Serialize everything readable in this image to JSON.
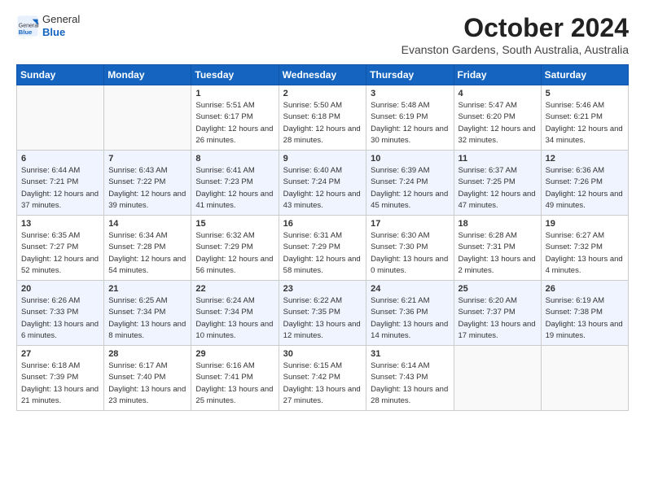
{
  "header": {
    "logo_general": "General",
    "logo_blue": "Blue",
    "month_year": "October 2024",
    "location": "Evanston Gardens, South Australia, Australia"
  },
  "weekdays": [
    "Sunday",
    "Monday",
    "Tuesday",
    "Wednesday",
    "Thursday",
    "Friday",
    "Saturday"
  ],
  "weeks": [
    [
      {
        "day": "",
        "sunrise": "",
        "sunset": "",
        "daylight": ""
      },
      {
        "day": "",
        "sunrise": "",
        "sunset": "",
        "daylight": ""
      },
      {
        "day": "1",
        "sunrise": "Sunrise: 5:51 AM",
        "sunset": "Sunset: 6:17 PM",
        "daylight": "Daylight: 12 hours and 26 minutes."
      },
      {
        "day": "2",
        "sunrise": "Sunrise: 5:50 AM",
        "sunset": "Sunset: 6:18 PM",
        "daylight": "Daylight: 12 hours and 28 minutes."
      },
      {
        "day": "3",
        "sunrise": "Sunrise: 5:48 AM",
        "sunset": "Sunset: 6:19 PM",
        "daylight": "Daylight: 12 hours and 30 minutes."
      },
      {
        "day": "4",
        "sunrise": "Sunrise: 5:47 AM",
        "sunset": "Sunset: 6:20 PM",
        "daylight": "Daylight: 12 hours and 32 minutes."
      },
      {
        "day": "5",
        "sunrise": "Sunrise: 5:46 AM",
        "sunset": "Sunset: 6:21 PM",
        "daylight": "Daylight: 12 hours and 34 minutes."
      }
    ],
    [
      {
        "day": "6",
        "sunrise": "Sunrise: 6:44 AM",
        "sunset": "Sunset: 7:21 PM",
        "daylight": "Daylight: 12 hours and 37 minutes."
      },
      {
        "day": "7",
        "sunrise": "Sunrise: 6:43 AM",
        "sunset": "Sunset: 7:22 PM",
        "daylight": "Daylight: 12 hours and 39 minutes."
      },
      {
        "day": "8",
        "sunrise": "Sunrise: 6:41 AM",
        "sunset": "Sunset: 7:23 PM",
        "daylight": "Daylight: 12 hours and 41 minutes."
      },
      {
        "day": "9",
        "sunrise": "Sunrise: 6:40 AM",
        "sunset": "Sunset: 7:24 PM",
        "daylight": "Daylight: 12 hours and 43 minutes."
      },
      {
        "day": "10",
        "sunrise": "Sunrise: 6:39 AM",
        "sunset": "Sunset: 7:24 PM",
        "daylight": "Daylight: 12 hours and 45 minutes."
      },
      {
        "day": "11",
        "sunrise": "Sunrise: 6:37 AM",
        "sunset": "Sunset: 7:25 PM",
        "daylight": "Daylight: 12 hours and 47 minutes."
      },
      {
        "day": "12",
        "sunrise": "Sunrise: 6:36 AM",
        "sunset": "Sunset: 7:26 PM",
        "daylight": "Daylight: 12 hours and 49 minutes."
      }
    ],
    [
      {
        "day": "13",
        "sunrise": "Sunrise: 6:35 AM",
        "sunset": "Sunset: 7:27 PM",
        "daylight": "Daylight: 12 hours and 52 minutes."
      },
      {
        "day": "14",
        "sunrise": "Sunrise: 6:34 AM",
        "sunset": "Sunset: 7:28 PM",
        "daylight": "Daylight: 12 hours and 54 minutes."
      },
      {
        "day": "15",
        "sunrise": "Sunrise: 6:32 AM",
        "sunset": "Sunset: 7:29 PM",
        "daylight": "Daylight: 12 hours and 56 minutes."
      },
      {
        "day": "16",
        "sunrise": "Sunrise: 6:31 AM",
        "sunset": "Sunset: 7:29 PM",
        "daylight": "Daylight: 12 hours and 58 minutes."
      },
      {
        "day": "17",
        "sunrise": "Sunrise: 6:30 AM",
        "sunset": "Sunset: 7:30 PM",
        "daylight": "Daylight: 13 hours and 0 minutes."
      },
      {
        "day": "18",
        "sunrise": "Sunrise: 6:28 AM",
        "sunset": "Sunset: 7:31 PM",
        "daylight": "Daylight: 13 hours and 2 minutes."
      },
      {
        "day": "19",
        "sunrise": "Sunrise: 6:27 AM",
        "sunset": "Sunset: 7:32 PM",
        "daylight": "Daylight: 13 hours and 4 minutes."
      }
    ],
    [
      {
        "day": "20",
        "sunrise": "Sunrise: 6:26 AM",
        "sunset": "Sunset: 7:33 PM",
        "daylight": "Daylight: 13 hours and 6 minutes."
      },
      {
        "day": "21",
        "sunrise": "Sunrise: 6:25 AM",
        "sunset": "Sunset: 7:34 PM",
        "daylight": "Daylight: 13 hours and 8 minutes."
      },
      {
        "day": "22",
        "sunrise": "Sunrise: 6:24 AM",
        "sunset": "Sunset: 7:34 PM",
        "daylight": "Daylight: 13 hours and 10 minutes."
      },
      {
        "day": "23",
        "sunrise": "Sunrise: 6:22 AM",
        "sunset": "Sunset: 7:35 PM",
        "daylight": "Daylight: 13 hours and 12 minutes."
      },
      {
        "day": "24",
        "sunrise": "Sunrise: 6:21 AM",
        "sunset": "Sunset: 7:36 PM",
        "daylight": "Daylight: 13 hours and 14 minutes."
      },
      {
        "day": "25",
        "sunrise": "Sunrise: 6:20 AM",
        "sunset": "Sunset: 7:37 PM",
        "daylight": "Daylight: 13 hours and 17 minutes."
      },
      {
        "day": "26",
        "sunrise": "Sunrise: 6:19 AM",
        "sunset": "Sunset: 7:38 PM",
        "daylight": "Daylight: 13 hours and 19 minutes."
      }
    ],
    [
      {
        "day": "27",
        "sunrise": "Sunrise: 6:18 AM",
        "sunset": "Sunset: 7:39 PM",
        "daylight": "Daylight: 13 hours and 21 minutes."
      },
      {
        "day": "28",
        "sunrise": "Sunrise: 6:17 AM",
        "sunset": "Sunset: 7:40 PM",
        "daylight": "Daylight: 13 hours and 23 minutes."
      },
      {
        "day": "29",
        "sunrise": "Sunrise: 6:16 AM",
        "sunset": "Sunset: 7:41 PM",
        "daylight": "Daylight: 13 hours and 25 minutes."
      },
      {
        "day": "30",
        "sunrise": "Sunrise: 6:15 AM",
        "sunset": "Sunset: 7:42 PM",
        "daylight": "Daylight: 13 hours and 27 minutes."
      },
      {
        "day": "31",
        "sunrise": "Sunrise: 6:14 AM",
        "sunset": "Sunset: 7:43 PM",
        "daylight": "Daylight: 13 hours and 28 minutes."
      },
      {
        "day": "",
        "sunrise": "",
        "sunset": "",
        "daylight": ""
      },
      {
        "day": "",
        "sunrise": "",
        "sunset": "",
        "daylight": ""
      }
    ]
  ]
}
